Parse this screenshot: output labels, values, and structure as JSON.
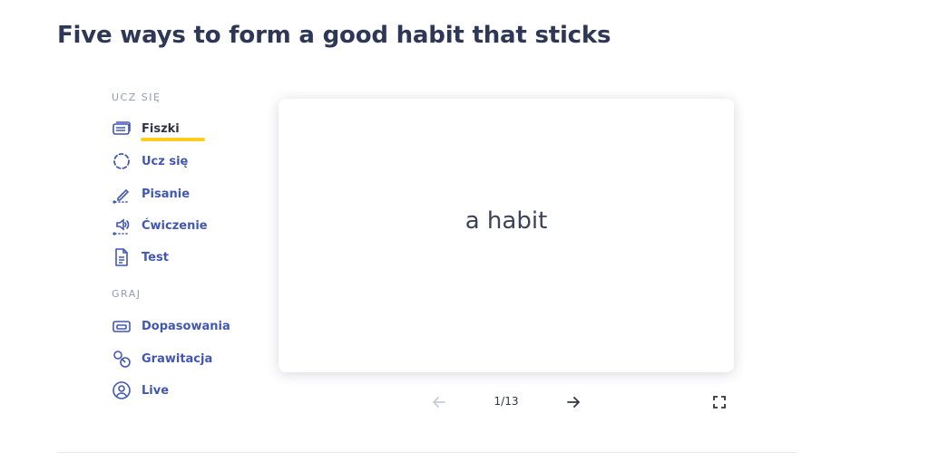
{
  "page": {
    "title": "Five ways to form a good habit that sticks"
  },
  "sidebar": {
    "study_heading": "UCZ SIĘ",
    "study_items": [
      {
        "label": "Fiszki",
        "icon": "flashcards-icon",
        "active": true
      },
      {
        "label": "Ucz się",
        "icon": "learn-icon",
        "active": false
      },
      {
        "label": "Pisanie",
        "icon": "write-icon",
        "active": false
      },
      {
        "label": "Ćwiczenie",
        "icon": "spell-icon",
        "active": false
      },
      {
        "label": "Test",
        "icon": "test-icon",
        "active": false
      }
    ],
    "play_heading": "GRAJ",
    "play_items": [
      {
        "label": "Dopasowania",
        "icon": "match-icon"
      },
      {
        "label": "Grawitacja",
        "icon": "gravity-icon"
      },
      {
        "label": "Live",
        "icon": "live-icon"
      }
    ]
  },
  "card": {
    "term": "a habit"
  },
  "navigation": {
    "counter": "1/13",
    "prev_icon": "arrow-left-icon",
    "next_icon": "arrow-right-icon",
    "fullscreen_icon": "fullscreen-icon"
  },
  "colors": {
    "title": "#2e3856",
    "link": "#4257b2",
    "active_underline": "#ffcd1f",
    "section_heading": "#939bb4",
    "disabled_arrow": "#c7cbd6"
  }
}
